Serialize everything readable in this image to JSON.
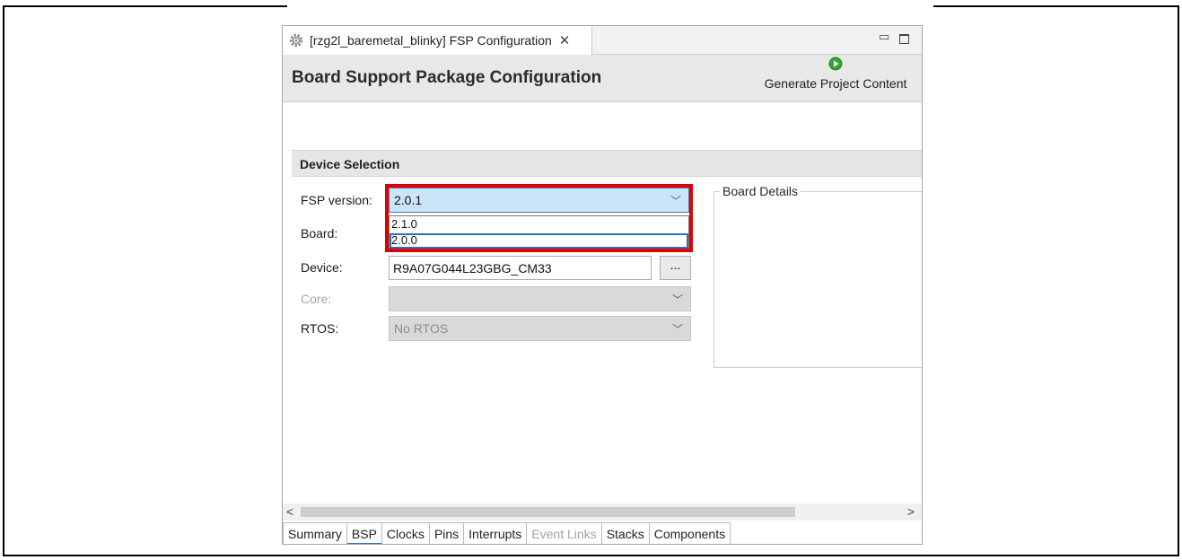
{
  "editor_tab": {
    "title": "[rzg2l_baremetal_blinky] FSP Configuration",
    "close_glyph": "✕"
  },
  "window_controls": {
    "minimize": "▭"
  },
  "header": {
    "title": "Board Support Package Configuration",
    "generate_label": "Generate Project Content",
    "accent_color": "#2e8b2e"
  },
  "section": {
    "title": "Device Selection"
  },
  "fields": {
    "fsp_version": {
      "label": "FSP version:",
      "value": "2.0.1"
    },
    "board": {
      "label": "Board:"
    },
    "device": {
      "label": "Device:",
      "value": "R9A07G044L23GBG_CM33",
      "browse_label": "..."
    },
    "core": {
      "label": "Core:",
      "value": ""
    },
    "rtos": {
      "label": "RTOS:",
      "value": "No RTOS"
    }
  },
  "dropdown": {
    "options": [
      "2.1.0",
      "2.0.0"
    ],
    "selected": "2.0.0"
  },
  "highlight_color": "#e00000",
  "board_details": {
    "title": "Board Details"
  },
  "scrollbar": {
    "left": "<",
    "right": ">"
  },
  "bottom_tabs": [
    {
      "label": "Summary",
      "state": "normal"
    },
    {
      "label": "BSP",
      "state": "active"
    },
    {
      "label": "Clocks",
      "state": "normal"
    },
    {
      "label": "Pins",
      "state": "normal"
    },
    {
      "label": "Interrupts",
      "state": "normal"
    },
    {
      "label": "Event Links",
      "state": "disabled"
    },
    {
      "label": "Stacks",
      "state": "normal"
    },
    {
      "label": "Components",
      "state": "normal"
    }
  ],
  "icons": [
    "gear-icon",
    "run-icon",
    "chevron-down-icon",
    "close-icon"
  ]
}
